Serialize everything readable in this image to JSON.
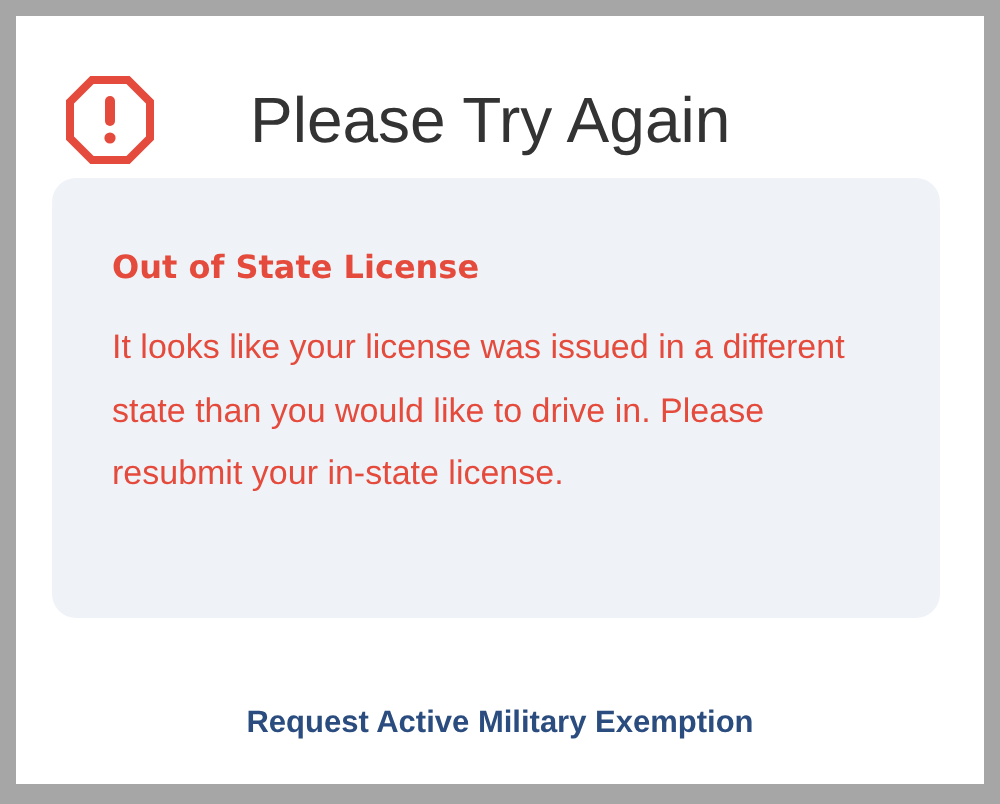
{
  "title": "Please Try Again",
  "message": {
    "heading": "Out of State License",
    "body": "It looks like your license was issued in a different state than you would like to drive in. Please resubmit your in-state license."
  },
  "link": "Request Active Military Exemption"
}
